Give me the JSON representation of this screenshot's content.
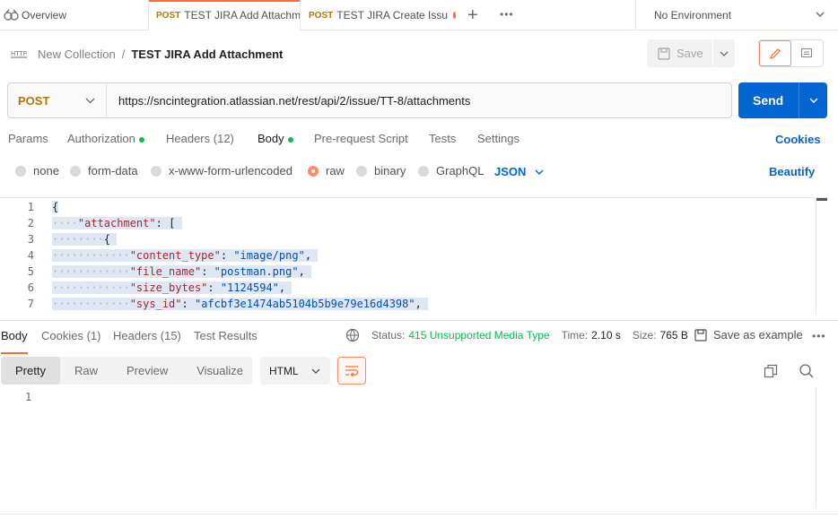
{
  "tabs": {
    "overview": "Overview",
    "attach": {
      "method": "POST",
      "title": "TEST JIRA Add Attachm"
    },
    "create": {
      "method": "POST",
      "title": "TEST JIRA Create Issu"
    }
  },
  "environment": "No Environment",
  "breadcrumb": {
    "collection": "New Collection",
    "separator": "/",
    "request": "TEST JIRA Add Attachment"
  },
  "save_label": "Save",
  "request": {
    "method": "POST",
    "url": "https://sncintegration.atlassian.net/rest/api/2/issue/TT-8/attachments",
    "send_label": "Send"
  },
  "request_tabs": [
    {
      "label": "Params"
    },
    {
      "label": "Authorization"
    },
    {
      "label": "Headers",
      "count": "(12)"
    },
    {
      "label": "Body"
    },
    {
      "label": "Pre-request Script"
    },
    {
      "label": "Tests"
    },
    {
      "label": "Settings"
    }
  ],
  "cookies_label": "Cookies",
  "body_types": [
    "none",
    "form-data",
    "x-www-form-urlencoded",
    "raw",
    "binary",
    "GraphQL"
  ],
  "body_format": "JSON",
  "beautify_label": "Beautify",
  "editor": {
    "line_numbers": [
      "1",
      "2",
      "3",
      "4",
      "5",
      "6",
      "7"
    ],
    "open_brace": "{",
    "attachment_key": "\"attachment\"",
    "colon": ":",
    "open_bracket": "[",
    "content_type_key": "\"content_type\"",
    "content_type_val": "\"image/png\"",
    "file_name_key": "\"file_name\"",
    "file_name_val": "\"postman.png\"",
    "size_key": "\"size_bytes\"",
    "size_val": "\"1124594\"",
    "sysid_key": "\"sys_id\"",
    "sysid_val": "\"afcbf3e1474ab5104b5b9e79e16d4398\"",
    "comma": ","
  },
  "response_tabs": [
    {
      "label": "Body"
    },
    {
      "label": "Cookies",
      "count": "(1)"
    },
    {
      "label": "Headers",
      "count": "(15)"
    },
    {
      "label": "Test Results"
    }
  ],
  "status": {
    "status_label": "Status:",
    "status_value": "415 Unsupported Media Type",
    "time_label": "Time:",
    "time_value": "2.10 s",
    "size_label": "Size:",
    "size_value": "765 B"
  },
  "save_example_label": "Save as example",
  "view_modes": [
    "Pretty",
    "Raw",
    "Preview",
    "Visualize"
  ],
  "response_format": "HTML",
  "response_line_number": "1",
  "colors": {
    "accent": "#ff6c37",
    "primary": "#0265d2",
    "success": "#0cbb52",
    "post_method": "#ad7a03"
  }
}
